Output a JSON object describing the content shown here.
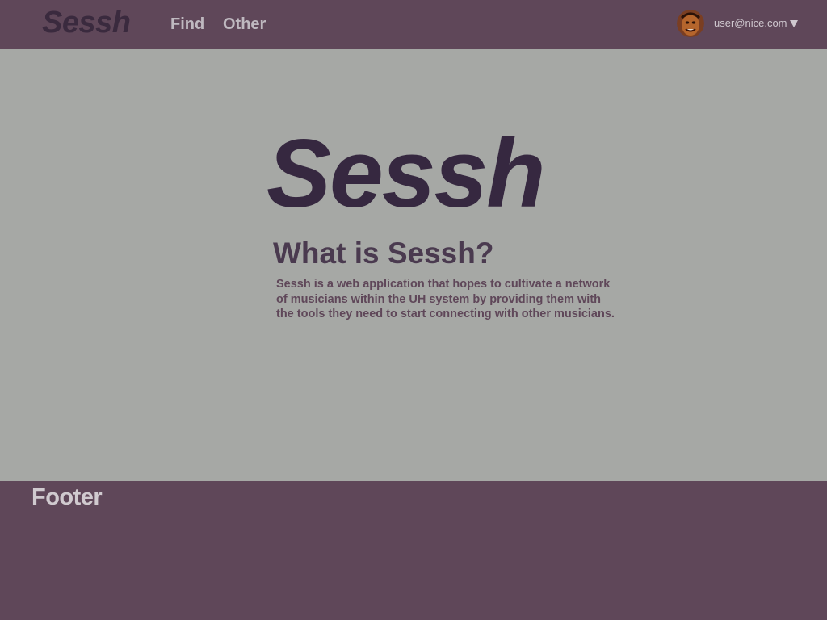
{
  "navbar": {
    "brand": "Sessh",
    "links": [
      "Find",
      "Other"
    ],
    "user": {
      "email": "user@nice.com",
      "avatar_icon": "user-avatar-icon"
    }
  },
  "main": {
    "logo": "Sessh",
    "heading": "What is Sessh?",
    "description": "Sessh is a web application that hopes to cultivate a network of musicians within the UH system by providing them with the tools they need to start connecting with other musicians."
  },
  "footer": {
    "title": "Footer"
  },
  "colors": {
    "nav_bg": "#5F4759",
    "body_bg": "#A6A8A5",
    "brand_dark": "#362840",
    "nav_text": "#BFB9C0"
  }
}
